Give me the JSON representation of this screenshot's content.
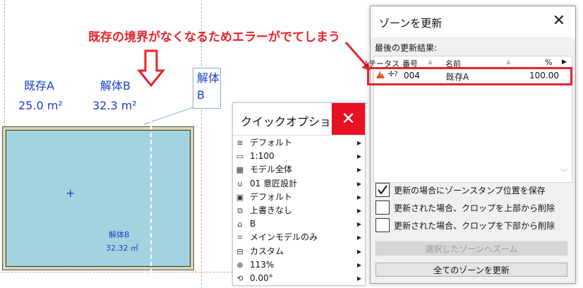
{
  "annotation": "既存の境界がなくなるためエラーがでてしまう",
  "zones": {
    "a": {
      "name": "既存A",
      "area": "25.0 m²"
    },
    "b": {
      "name": "解体B",
      "area": "32.3 m²"
    },
    "callout_lines": [
      "解体",
      "B"
    ],
    "stamp": {
      "name": "解体B",
      "area": "32.32 ㎡"
    },
    "cross": "+"
  },
  "quick_options": {
    "title": "クイックオプション",
    "close": "✕",
    "items": [
      {
        "icon": "layers-icon",
        "label": "デフォルト"
      },
      {
        "icon": "scale-icon",
        "label": "1:100"
      },
      {
        "icon": "model-view-icon",
        "label": "モデル全体"
      },
      {
        "icon": "pen-set-icon",
        "label": "01 意匠設計"
      },
      {
        "icon": "display-icon",
        "label": "デフォルト"
      },
      {
        "icon": "override-icon",
        "label": "上書きなし"
      },
      {
        "icon": "renovation-icon",
        "label": "B"
      },
      {
        "icon": "structure-icon",
        "label": "メインモデルのみ"
      },
      {
        "icon": "dimension-icon",
        "label": "カスタム"
      },
      {
        "icon": "zoom-icon",
        "label": "113%"
      },
      {
        "icon": "rotate-icon",
        "label": "0.00°"
      }
    ]
  },
  "zone_dialog": {
    "title": "ゾーンを更新",
    "close": "✕",
    "subtitle": "最後の更新結果:",
    "columns": {
      "status": "ステータス",
      "number": "番号",
      "name": "名前",
      "percent": "%"
    },
    "row": {
      "status_icon": "warning-icon",
      "link_icon": "✢?",
      "number": "004",
      "name": "既存A",
      "percent": "100.00"
    },
    "options": [
      {
        "checked": true,
        "label": "更新の場合にゾーンスタンプ位置を保存"
      },
      {
        "checked": false,
        "label": "更新された場合、クロップを上部から削除"
      },
      {
        "checked": false,
        "label": "更新された場合、クロップを下部から削除"
      }
    ],
    "zoom_button": "選択したゾーンへズーム",
    "update_all_button": "全てのゾーンを更新"
  },
  "colors": {
    "accent_red": "#e8222a",
    "zone_fill": "#a4d3e0",
    "label_blue": "#1a3fc8"
  }
}
